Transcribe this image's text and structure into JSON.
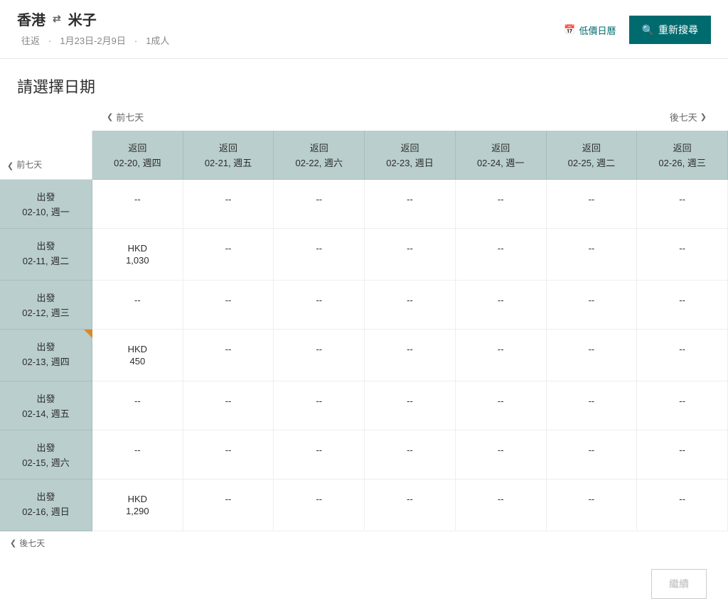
{
  "header": {
    "origin": "香港",
    "destination": "米子",
    "tripType": "往返",
    "dateRange": "1月23日-2月9日",
    "pax": "1成人",
    "calendarLink": "低價日曆",
    "searchBtn": "重新搜尋"
  },
  "title": "請選擇日期",
  "nav": {
    "prev7": "前七天",
    "next7": "後七天"
  },
  "columns": [
    {
      "label": "返回",
      "date": "02-20, 週四"
    },
    {
      "label": "返回",
      "date": "02-21, 週五"
    },
    {
      "label": "返回",
      "date": "02-22, 週六"
    },
    {
      "label": "返回",
      "date": "02-23, 週日"
    },
    {
      "label": "返回",
      "date": "02-24, 週一"
    },
    {
      "label": "返回",
      "date": "02-25, 週二"
    },
    {
      "label": "返回",
      "date": "02-26, 週三"
    }
  ],
  "rows": [
    {
      "label": "出發",
      "date": "02-10, 週一",
      "marker": false,
      "cells": [
        "--",
        "--",
        "--",
        "--",
        "--",
        "--",
        "--"
      ]
    },
    {
      "label": "出發",
      "date": "02-11, 週二",
      "marker": false,
      "cells": [
        {
          "cur": "HKD",
          "val": "1,030"
        },
        "--",
        "--",
        "--",
        "--",
        "--",
        "--"
      ]
    },
    {
      "label": "出發",
      "date": "02-12, 週三",
      "marker": false,
      "cells": [
        "--",
        "--",
        "--",
        "--",
        "--",
        "--",
        "--"
      ]
    },
    {
      "label": "出發",
      "date": "02-13, 週四",
      "marker": true,
      "cells": [
        {
          "cur": "HKD",
          "val": "450"
        },
        "--",
        "--",
        "--",
        "--",
        "--",
        "--"
      ]
    },
    {
      "label": "出發",
      "date": "02-14, 週五",
      "marker": false,
      "cells": [
        "--",
        "--",
        "--",
        "--",
        "--",
        "--",
        "--"
      ]
    },
    {
      "label": "出發",
      "date": "02-15, 週六",
      "marker": false,
      "cells": [
        "--",
        "--",
        "--",
        "--",
        "--",
        "--",
        "--"
      ]
    },
    {
      "label": "出發",
      "date": "02-16, 週日",
      "marker": false,
      "cells": [
        {
          "cur": "HKD",
          "val": "1,290"
        },
        "--",
        "--",
        "--",
        "--",
        "--",
        "--"
      ]
    }
  ],
  "continueBtn": "繼續",
  "dot": "·"
}
